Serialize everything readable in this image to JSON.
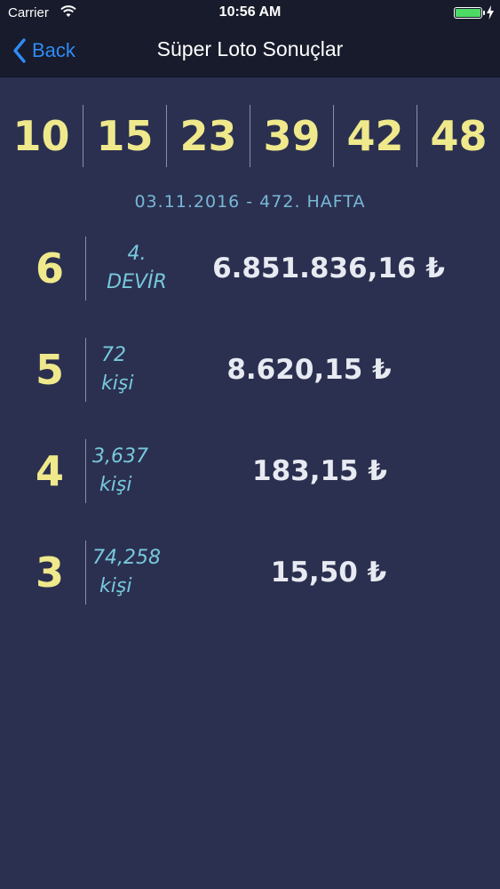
{
  "status_bar": {
    "carrier": "Carrier",
    "time": "10:56 AM"
  },
  "nav": {
    "back_label": "Back",
    "title": "Süper Loto Sonuçlar"
  },
  "drawn_numbers": [
    "10",
    "15",
    "23",
    "39",
    "42",
    "48"
  ],
  "draw_info": "03.11.2016 - 472. HAFTA",
  "prize_rows": [
    {
      "match": "6",
      "line1": "4.",
      "line2": "DEVİR",
      "amount": "6.851.836,16 ₺"
    },
    {
      "match": "5",
      "line1": "72",
      "line2": "kişi",
      "amount": "8.620,15 ₺"
    },
    {
      "match": "4",
      "line1": "3,637",
      "line2": "kişi",
      "amount": "183,15 ₺"
    },
    {
      "match": "3",
      "line1": "74,258",
      "line2": "kişi",
      "amount": "15,50 ₺"
    }
  ],
  "colors": {
    "background": "#2b3050",
    "nav_bar": "#171b2b",
    "ball": "#efe98c",
    "accent_blue": "#2f8cf6",
    "devir_orange": "#f08a24",
    "winners": "#78c8dc"
  },
  "icons": {
    "back": "chevron-left-icon",
    "wifi": "wifi-icon",
    "battery": "battery-icon",
    "charging": "bolt-icon"
  }
}
